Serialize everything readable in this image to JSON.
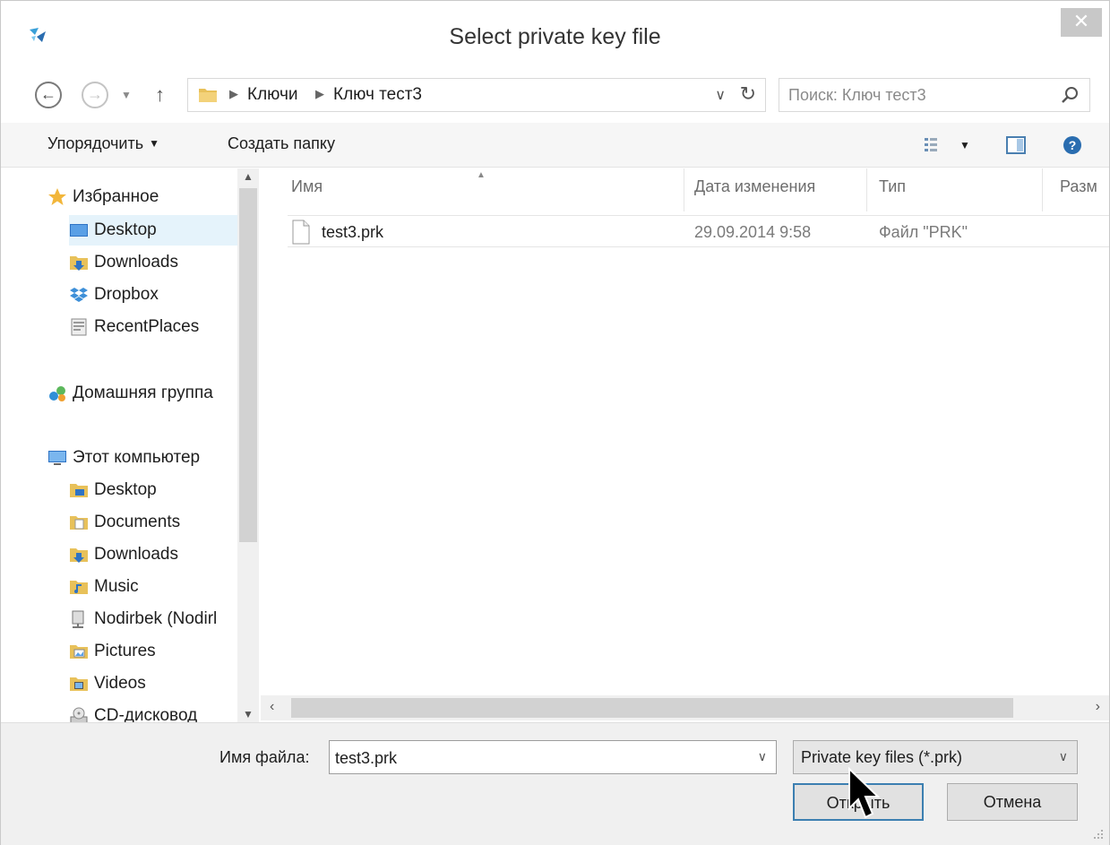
{
  "window": {
    "title": "Select private key file",
    "close_label": "✕"
  },
  "address_bar": {
    "crumbs": [
      "Ключи",
      "Ключ тест3"
    ],
    "search_placeholder": "Поиск: Ключ тест3"
  },
  "toolbar": {
    "organize_label": "Упорядочить",
    "new_folder_label": "Создать папку"
  },
  "nav_pane": {
    "favorites": {
      "label": "Избранное",
      "items": [
        {
          "label": "Desktop",
          "icon": "desktop-icon"
        },
        {
          "label": "Downloads",
          "icon": "downloads-folder-icon"
        },
        {
          "label": "Dropbox",
          "icon": "dropbox-icon"
        },
        {
          "label": "RecentPlaces",
          "icon": "recent-places-icon"
        }
      ]
    },
    "homegroup": {
      "label": "Домашняя группа"
    },
    "computer": {
      "label": "Этот компьютер",
      "items": [
        {
          "label": "Desktop",
          "icon": "desktop-folder-icon"
        },
        {
          "label": "Documents",
          "icon": "documents-folder-icon"
        },
        {
          "label": "Downloads",
          "icon": "downloads-folder-icon"
        },
        {
          "label": "Music",
          "icon": "music-folder-icon"
        },
        {
          "label": "Nodirbek (Nodirl",
          "icon": "network-drive-icon"
        },
        {
          "label": "Pictures",
          "icon": "pictures-folder-icon"
        },
        {
          "label": "Videos",
          "icon": "videos-folder-icon"
        },
        {
          "label": "CD-дисковод",
          "icon": "cd-drive-icon"
        }
      ]
    },
    "selected": "Desktop"
  },
  "file_list": {
    "columns": [
      "Имя",
      "Дата изменения",
      "Тип",
      "Разм"
    ],
    "rows": [
      {
        "name": "test3.prk",
        "date": "29.09.2014 9:58",
        "type": "Файл \"PRK\""
      }
    ]
  },
  "bottom": {
    "file_name_label": "Имя файла:",
    "file_name_value": "test3.prk",
    "filter_value": "Private key files (*.prk)",
    "open_label": "Открыть",
    "cancel_label": "Отмена"
  },
  "colors": {
    "selection": "#e5f3fb",
    "primary_border": "#3c7fb1",
    "folder": "#e8c15a"
  }
}
